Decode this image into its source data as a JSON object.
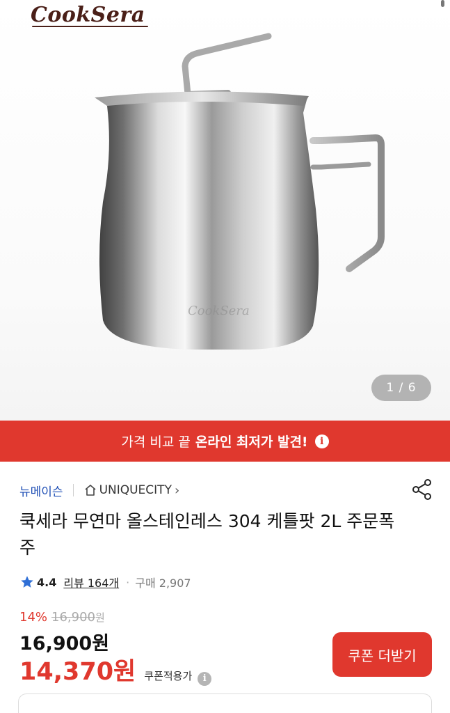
{
  "brand": {
    "logo_text": "CookSera"
  },
  "gallery": {
    "page_indicator": "1 / 6"
  },
  "promo": {
    "text": "가격 비교 끝",
    "strong_text": "온라인 최저가 발견!",
    "icon": "info-icon"
  },
  "seller": {
    "name": "뉴메이슨",
    "store_icon": "home-icon",
    "store_name": "UNIQUECITY",
    "chevron": "›",
    "share_icon": "share-icon"
  },
  "product": {
    "title": "쿡세라 무연마 올스테인레스 304 케틀팟 2L 주문폭주"
  },
  "rating": {
    "star_icon": "star-icon",
    "score": "4.4",
    "review_label": "리뷰 164개",
    "separator": "·",
    "purchase_label": "구매 2,907"
  },
  "pricing": {
    "discount_rate": "14%",
    "original_price": "16,900",
    "original_unit": "원",
    "sale_price": "16,900원",
    "coupon_price": "14,370원",
    "coupon_note": "쿠폰적용가",
    "coupon_button": "쿠폰 더받기"
  },
  "colors": {
    "accent_red": "#e0382e",
    "link_blue": "#1f4fb5",
    "logo_brown": "#4a1f18"
  }
}
